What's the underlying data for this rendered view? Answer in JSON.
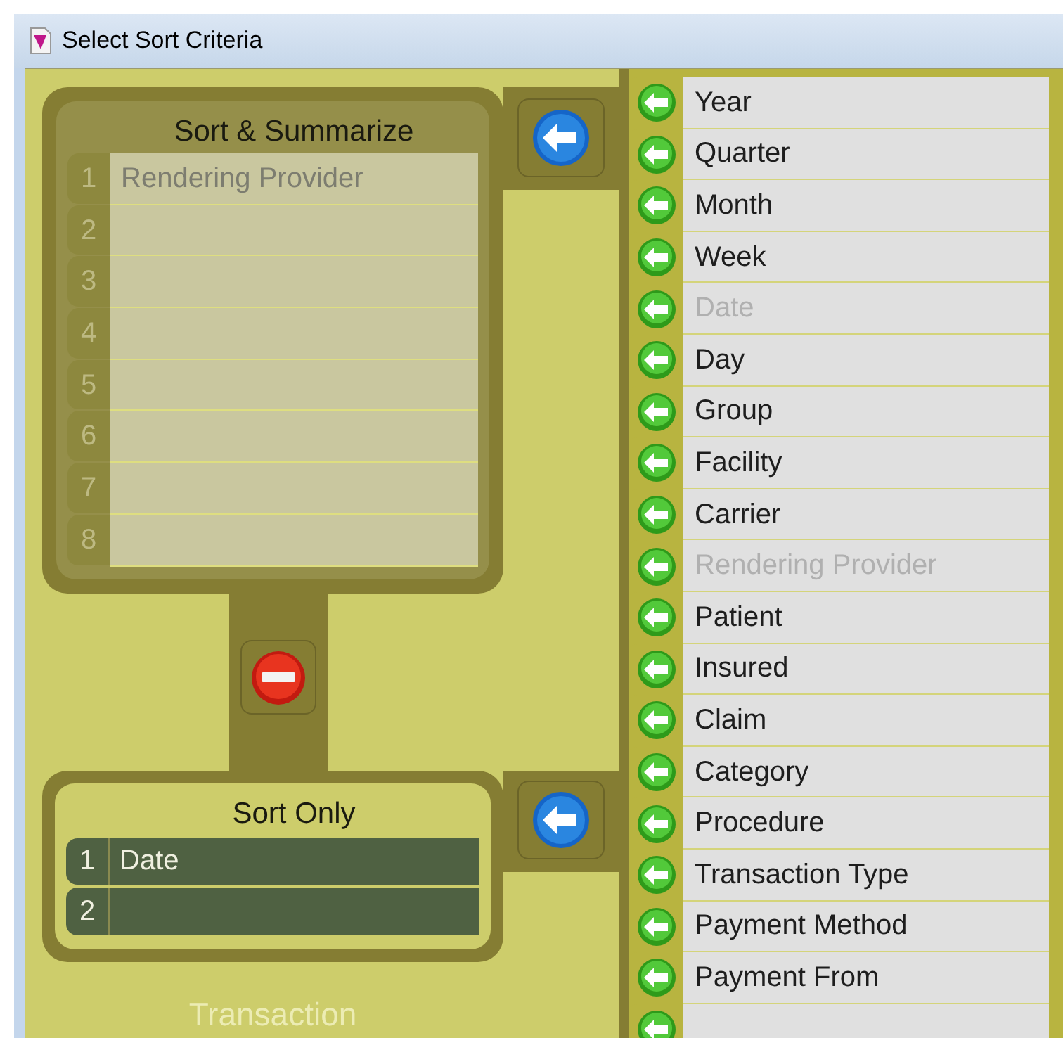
{
  "window": {
    "title": "Select Sort Criteria"
  },
  "sort_and_summarize": {
    "title": "Sort & Summarize",
    "rows": [
      {
        "number": "1",
        "value": "Rendering Provider"
      },
      {
        "number": "2"
      },
      {
        "number": "3"
      },
      {
        "number": "4"
      },
      {
        "number": "5"
      },
      {
        "number": "6"
      },
      {
        "number": "7"
      },
      {
        "number": "8"
      }
    ]
  },
  "sort_only": {
    "title": "Sort Only",
    "rows": [
      {
        "number": "1",
        "value": "Date"
      },
      {
        "number": "2"
      }
    ]
  },
  "section_label": "Transaction",
  "fields": [
    {
      "label": "Year",
      "disabled": false
    },
    {
      "label": "Quarter",
      "disabled": false
    },
    {
      "label": "Month",
      "disabled": false
    },
    {
      "label": "Week",
      "disabled": false
    },
    {
      "label": "Date",
      "disabled": true
    },
    {
      "label": "Day",
      "disabled": false
    },
    {
      "label": "Group",
      "disabled": false
    },
    {
      "label": "Facility",
      "disabled": false
    },
    {
      "label": "Carrier",
      "disabled": false
    },
    {
      "label": "Rendering Provider",
      "disabled": true
    },
    {
      "label": "Patient",
      "disabled": false
    },
    {
      "label": "Insured",
      "disabled": false
    },
    {
      "label": "Claim",
      "disabled": false
    },
    {
      "label": "Category",
      "disabled": false
    },
    {
      "label": "Procedure",
      "disabled": false
    },
    {
      "label": "Transaction Type",
      "disabled": false
    },
    {
      "label": "Payment Method",
      "disabled": false
    },
    {
      "label": "Payment From",
      "disabled": false
    }
  ],
  "more_below": true
}
